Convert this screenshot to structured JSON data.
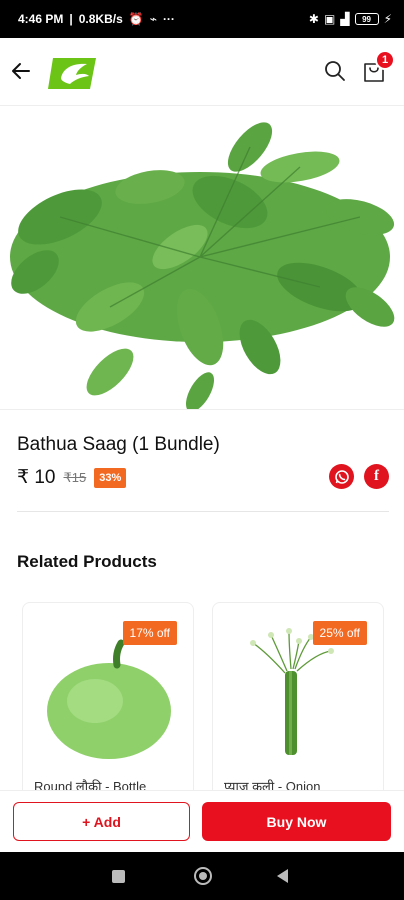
{
  "status_bar": {
    "time": "4:46 PM",
    "network_speed": "0.8KB/s",
    "more": "···",
    "battery": "99"
  },
  "header": {
    "back_icon": "arrow-left-icon",
    "logo": "app-logo",
    "search_icon": "search-icon",
    "cart_icon": "cart-icon",
    "cart_count": "1"
  },
  "product": {
    "title": "Bathua Saag (1 Bundle)",
    "price": "₹ 10",
    "mrp": "₹15",
    "discount": "33%"
  },
  "share": {
    "whatsapp_icon": "whatsapp-icon",
    "facebook_icon": "facebook-icon",
    "facebook_glyph": "f"
  },
  "related": {
    "title": "Related Products",
    "items": [
      {
        "name": "Round लौकी - Bottle",
        "badge": "17% off"
      },
      {
        "name": "प्याज कली - Onion",
        "badge": "25% off"
      }
    ]
  },
  "actions": {
    "add_label": "+ Add",
    "buy_label": "Buy Now"
  },
  "colors": {
    "primary": "#e8101f",
    "badge": "#f26a22",
    "logo_green": "#6cc417"
  }
}
